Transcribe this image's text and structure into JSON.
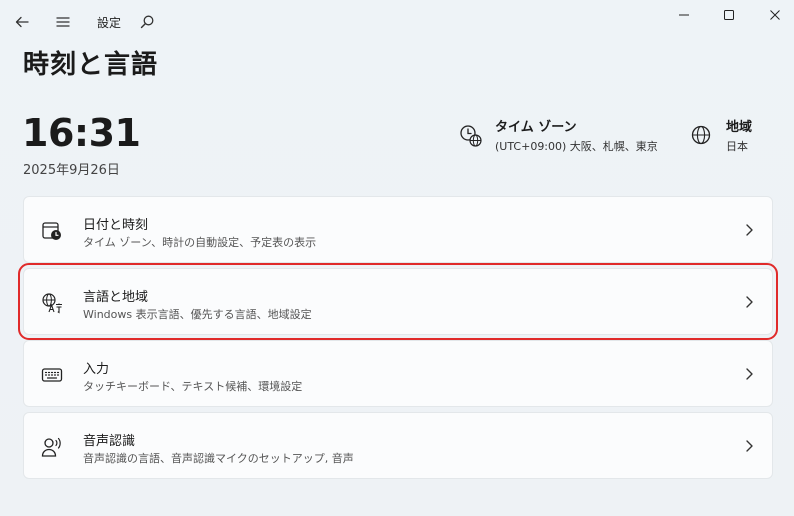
{
  "app": {
    "title": "設定",
    "back_icon": "back-arrow-icon",
    "menu_icon": "hamburger-menu-icon",
    "search_icon": "search-icon"
  },
  "window_controls": [
    "minimize",
    "maximize",
    "close"
  ],
  "page": {
    "title": "時刻と言語"
  },
  "clock": {
    "time": "16:31",
    "date": "2025年9月26日"
  },
  "timezone": {
    "title": "タイム ゾーン",
    "value": "(UTC+09:00) 大阪、札幌、東京",
    "icon": "clock-globe-icon"
  },
  "region": {
    "title": "地域",
    "value": "日本",
    "icon": "globe-icon"
  },
  "settings_items": [
    {
      "title": "日付と時刻",
      "subtitle": "タイム ゾーン、時計の自動設定、予定表の表示",
      "icon": "calendar-clock-icon"
    },
    {
      "title": "言語と地域",
      "subtitle": "Windows 表示言語、優先する言語、地域設定",
      "icon": "language-icon",
      "selected": true
    },
    {
      "title": "入力",
      "subtitle": "タッチキーボード、テキスト候補、環境設定",
      "icon": "keyboard-icon"
    },
    {
      "title": "音声認識",
      "subtitle": "音声認識の言語、音声認識マイクのセットアップ, 音声",
      "icon": "speech-icon"
    }
  ],
  "colors": {
    "highlight": "#e02a2a",
    "background": "#eef3f7",
    "card": "#fbfcfd"
  }
}
